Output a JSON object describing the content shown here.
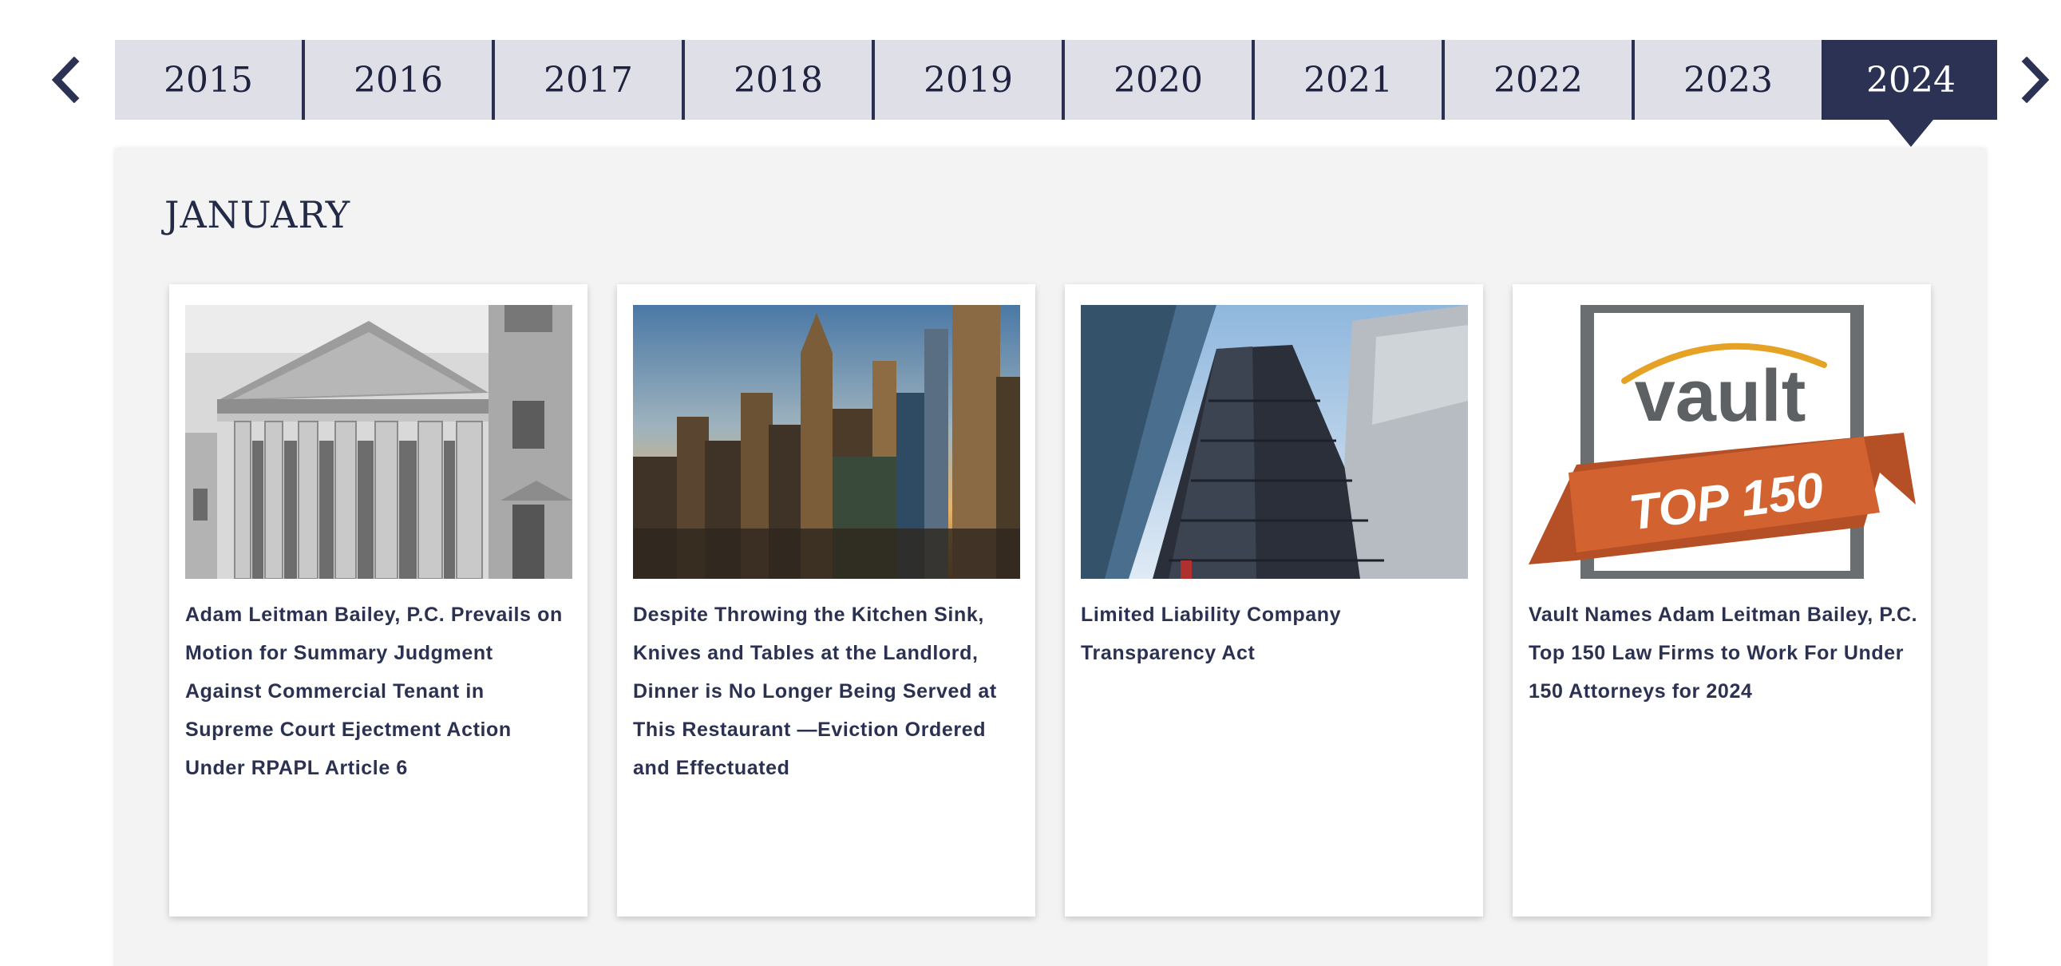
{
  "navigation": {
    "prev_icon": "chevron-left-icon",
    "next_icon": "chevron-right-icon"
  },
  "years": [
    "2015",
    "2016",
    "2017",
    "2018",
    "2019",
    "2020",
    "2021",
    "2022",
    "2023",
    "2024"
  ],
  "active_year": "2024",
  "colors": {
    "tab_bg": "#dfe0e7",
    "tab_active_bg": "#2b3253",
    "text_navy": "#232a47",
    "panel_bg": "#f3f3f3"
  },
  "month": "JANUARY",
  "articles": [
    {
      "title": "Adam Leitman Bailey, P.C. Prevails on Motion for Summary Judgment Against Commercial Tenant in Supreme Court Ejectment Action Under RPAPL Article 6",
      "image": "courthouse-columns-photo"
    },
    {
      "title": "Despite Throwing the Kitchen Sink, Knives and Tables at the Landlord, Dinner is No Longer Being Served at This Restaurant —Eviction Ordered and Effectuated",
      "image": "city-skyline-sunset-photo"
    },
    {
      "title": "Limited Liability Company Transparency Act",
      "image": "skyscrapers-looking-up-photo"
    },
    {
      "title": "Vault Names Adam Leitman Bailey, P.C. Top 150 Law Firms to Work For Under 150 Attorneys for 2024",
      "image": "vault-top-150-logo",
      "logo_text": "vault",
      "badge_text": "TOP 150"
    }
  ]
}
